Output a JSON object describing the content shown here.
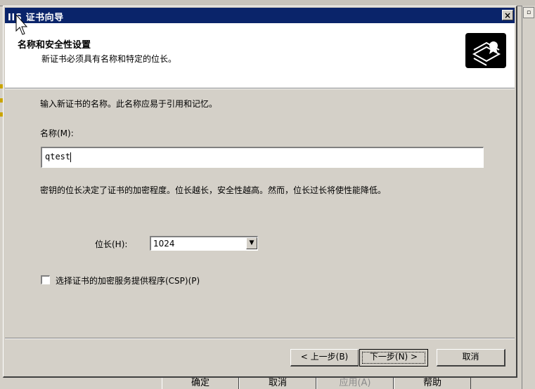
{
  "dialog": {
    "title": "IIS 证书向导",
    "close_label": "×",
    "header": {
      "title": "名称和安全性设置",
      "subtitle": "新证书必须具有名称和特定的位长。"
    },
    "intro": "输入新证书的名称。此名称应易于引用和记忆。",
    "name_label": "名称(M):",
    "name_value": "qtest",
    "key_description": "密钥的位长决定了证书的加密程度。位长越长，安全性越高。然而，位长过长将使性能降低。",
    "bit_length_label": "位长(H):",
    "bit_length_value": "1024",
    "csp_checkbox_label": "选择证书的加密服务提供程序(CSP)(P)",
    "csp_checked": false,
    "buttons": {
      "back": "< 上一步(B)",
      "next": "下一步(N) >",
      "cancel": "取消"
    }
  },
  "background_window": {
    "buttons": [
      {
        "label": "确定",
        "enabled": true
      },
      {
        "label": "取消",
        "enabled": true
      },
      {
        "label": "应用(A)",
        "enabled": false
      },
      {
        "label": "帮助",
        "enabled": true
      }
    ]
  },
  "icons": {
    "certificate": "certificate-icon",
    "close": "close-icon",
    "cursor": "mouse-cursor-icon",
    "dropdown": "chevron-down-icon"
  },
  "colors": {
    "titlebar": "#0a246a",
    "face": "#d4d0c8",
    "header_bg": "#ffffff"
  }
}
